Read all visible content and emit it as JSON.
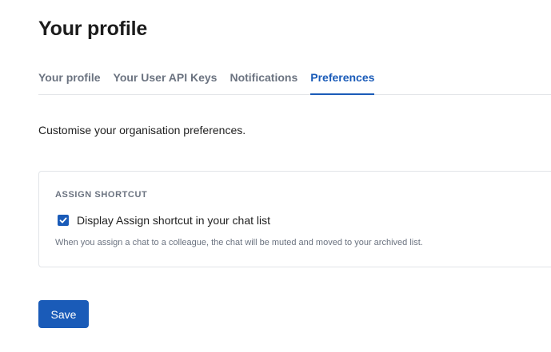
{
  "page": {
    "title": "Your profile"
  },
  "tabs": [
    {
      "label": "Your profile",
      "active": false
    },
    {
      "label": "Your User API Keys",
      "active": false
    },
    {
      "label": "Notifications",
      "active": false
    },
    {
      "label": "Preferences",
      "active": true
    }
  ],
  "intro": "Customise your organisation preferences.",
  "assign_shortcut": {
    "heading": "ASSIGN SHORTCUT",
    "checkbox_label": "Display Assign shortcut in your chat list",
    "checked": true,
    "hint": "When you assign a chat to a colleague, the chat will be muted and moved to your archived list."
  },
  "actions": {
    "save_label": "Save"
  },
  "colors": {
    "accent": "#1a5bb8",
    "muted_text": "#6b7380",
    "border": "#e1e4e8"
  }
}
